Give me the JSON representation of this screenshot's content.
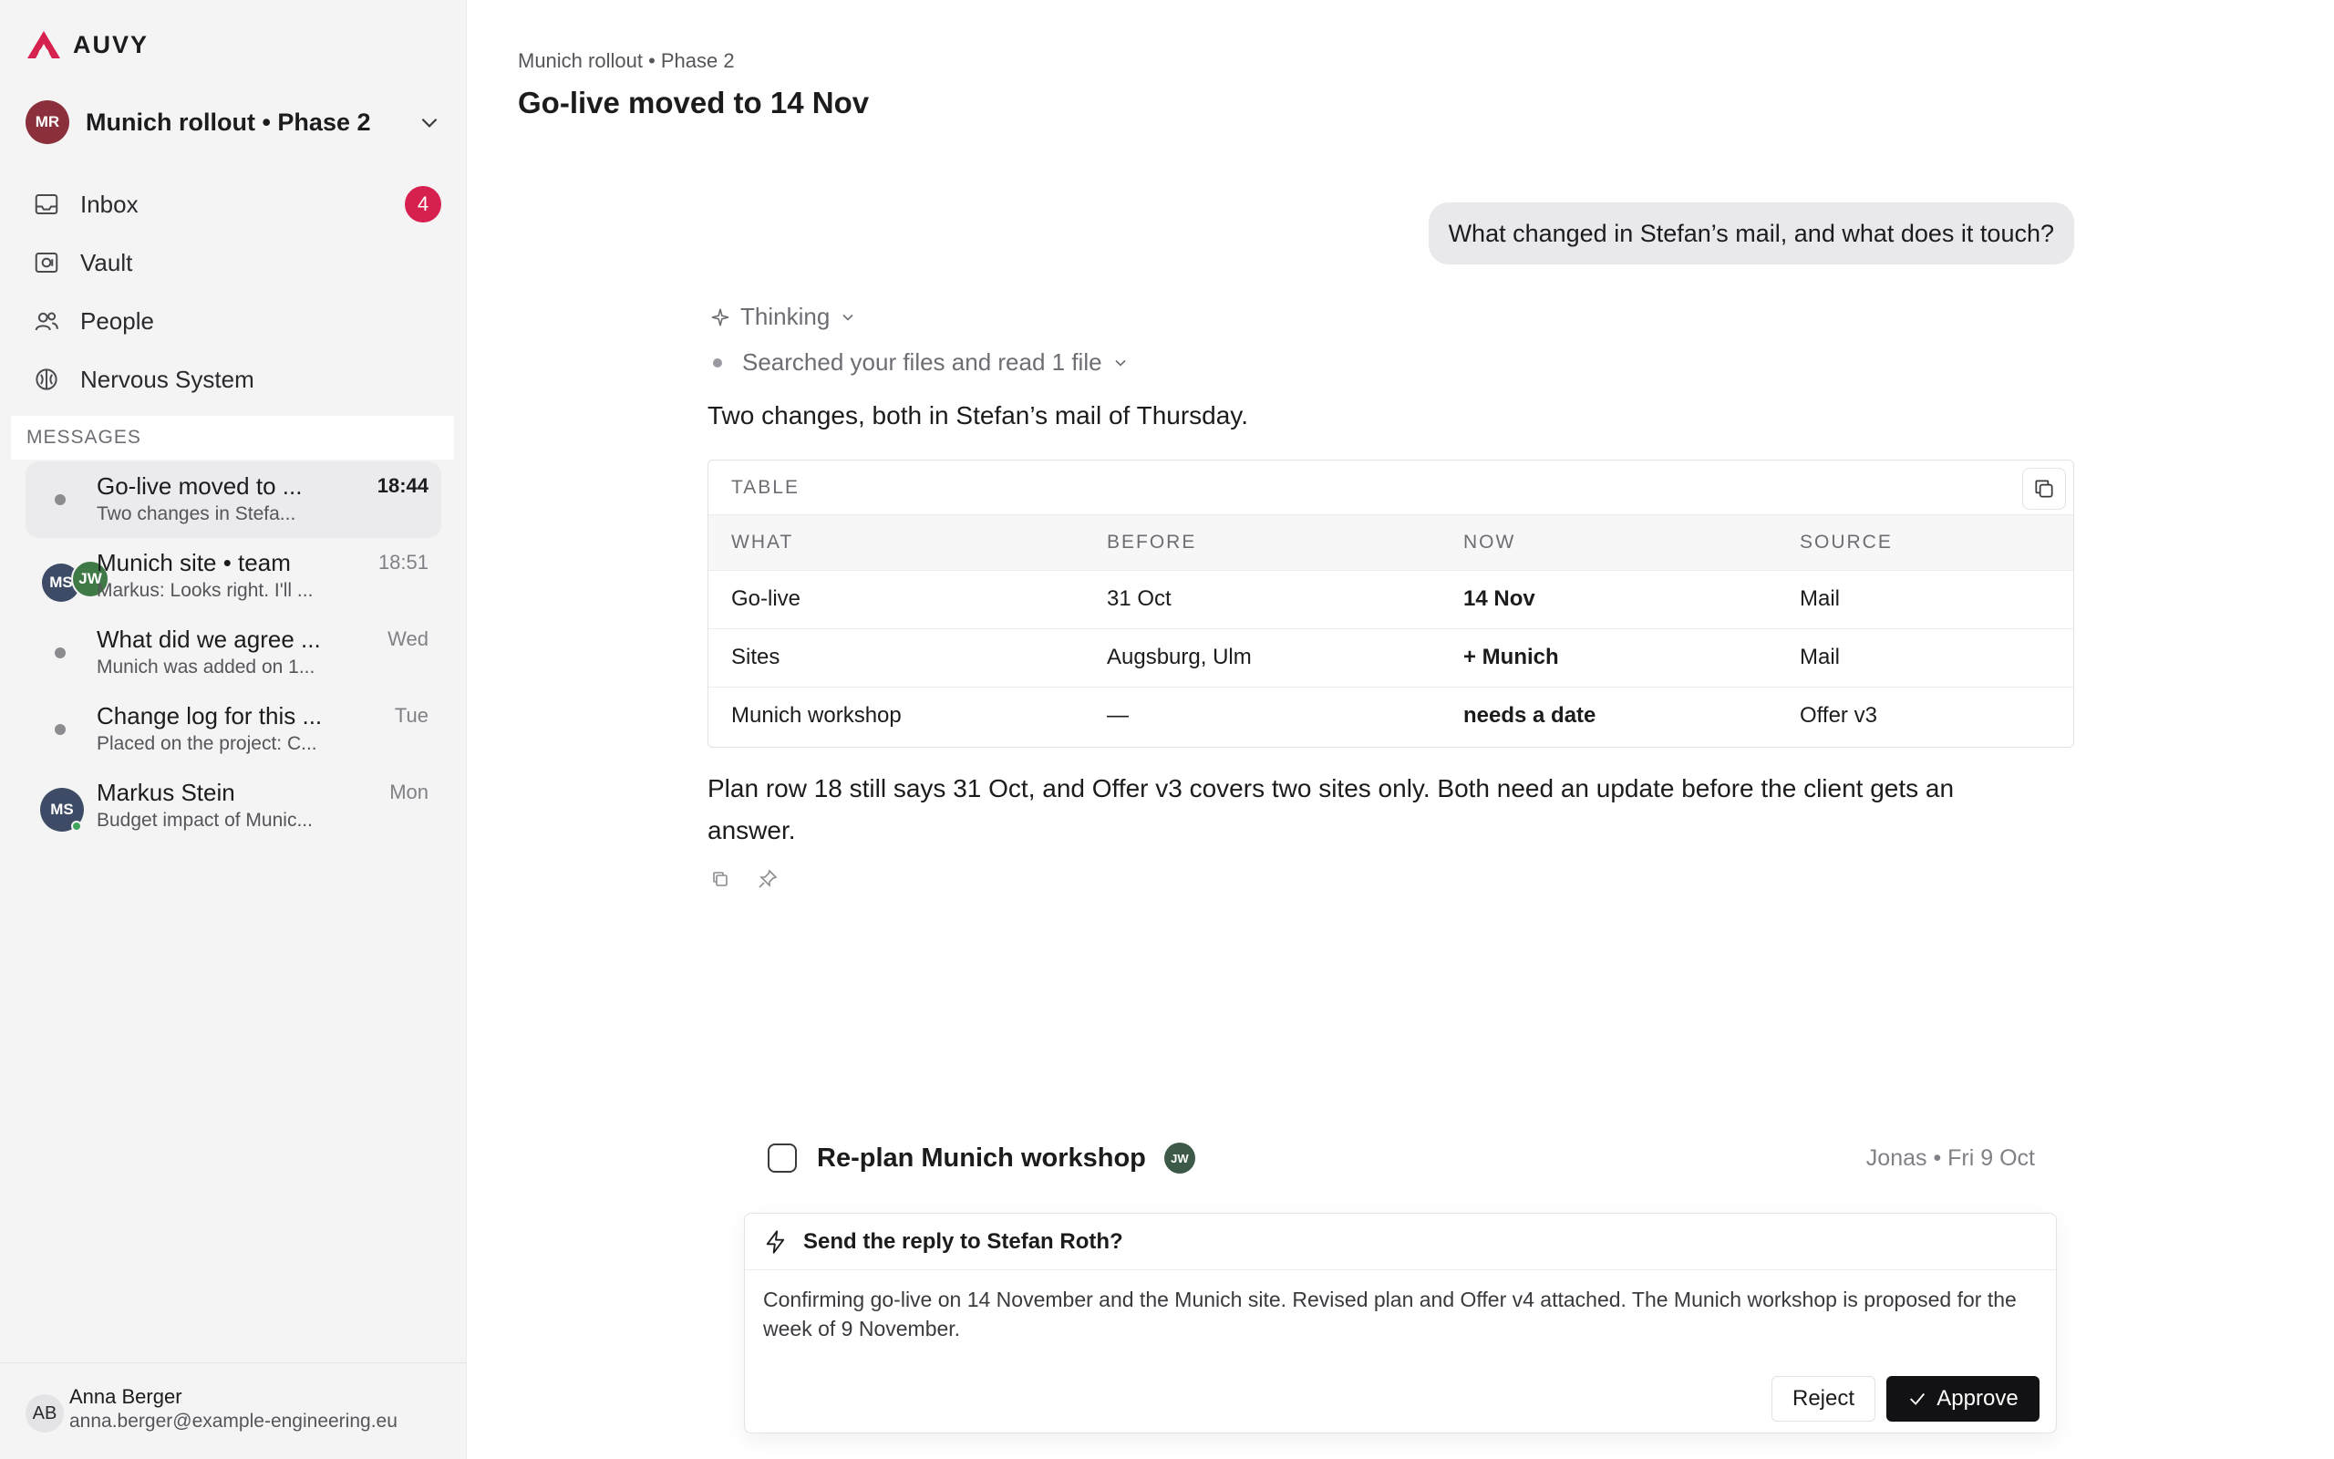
{
  "brand": {
    "name": "AUVY",
    "accent": "#d6204d"
  },
  "project": {
    "initials": "MR",
    "name": "Munich rollout • Phase 2"
  },
  "nav": [
    {
      "label": "Inbox",
      "icon": "inbox-icon",
      "badge": "4"
    },
    {
      "label": "Vault",
      "icon": "vault-icon"
    },
    {
      "label": "People",
      "icon": "people-icon"
    },
    {
      "label": "Nervous System",
      "icon": "brain-icon"
    }
  ],
  "messages_header": "MESSAGES",
  "messages": [
    {
      "title": "Go-live moved to ...",
      "preview": "Two changes in Stefa...",
      "time": "18:44"
    },
    {
      "title": "Munich site • team",
      "preview": "Markus: Looks right. I'll ...",
      "time": "18:51",
      "avatars": [
        "MS",
        "JW"
      ]
    },
    {
      "title": "What did we agree ...",
      "preview": "Munich was added on 1...",
      "time": "Wed"
    },
    {
      "title": "Change log for this ...",
      "preview": "Placed on the project: C...",
      "time": "Tue"
    },
    {
      "title": "Markus Stein",
      "preview": "Budget impact of Munic...",
      "time": "Mon",
      "avatar": "MS"
    }
  ],
  "user": {
    "initials": "AB",
    "name": "Anna Berger",
    "email": "anna.berger@example-engineering.eu"
  },
  "header": {
    "breadcrumb": "Munich rollout • Phase 2",
    "title": "Go-live moved to 14 Nov"
  },
  "chat": {
    "user_message": "What changed in Stefan’s mail, and what does it touch?",
    "thinking_label": "Thinking",
    "searched_label": "Searched your files and read 1 file",
    "intro": "Two changes, both in Stefan’s mail of Thursday.",
    "table": {
      "caption": "TABLE",
      "headers": [
        "WHAT",
        "BEFORE",
        "NOW",
        "SOURCE"
      ],
      "rows": [
        [
          "Go-live",
          "31 Oct",
          "14 Nov",
          "Mail"
        ],
        [
          "Sites",
          "Augsburg, Ulm",
          "+ Munich",
          "Mail"
        ],
        [
          "Munich workshop",
          "—",
          "needs a date",
          "Offer v3"
        ]
      ]
    },
    "body": "Plan row 18 still says 31 Oct, and Offer v3 covers two sites only. Both need an update before the client gets an answer."
  },
  "task": {
    "title": "Re-plan Munich workshop",
    "assignee": "JW",
    "meta": "Jonas • Fri 9 Oct"
  },
  "approval": {
    "title": "Send the reply to Stefan Roth?",
    "body": "Confirming go-live on 14 November and the Munich site. Revised plan and Offer v4 attached. The Munich workshop is proposed for the week of 9 November.",
    "reject_label": "Reject",
    "approve_label": "Approve"
  }
}
